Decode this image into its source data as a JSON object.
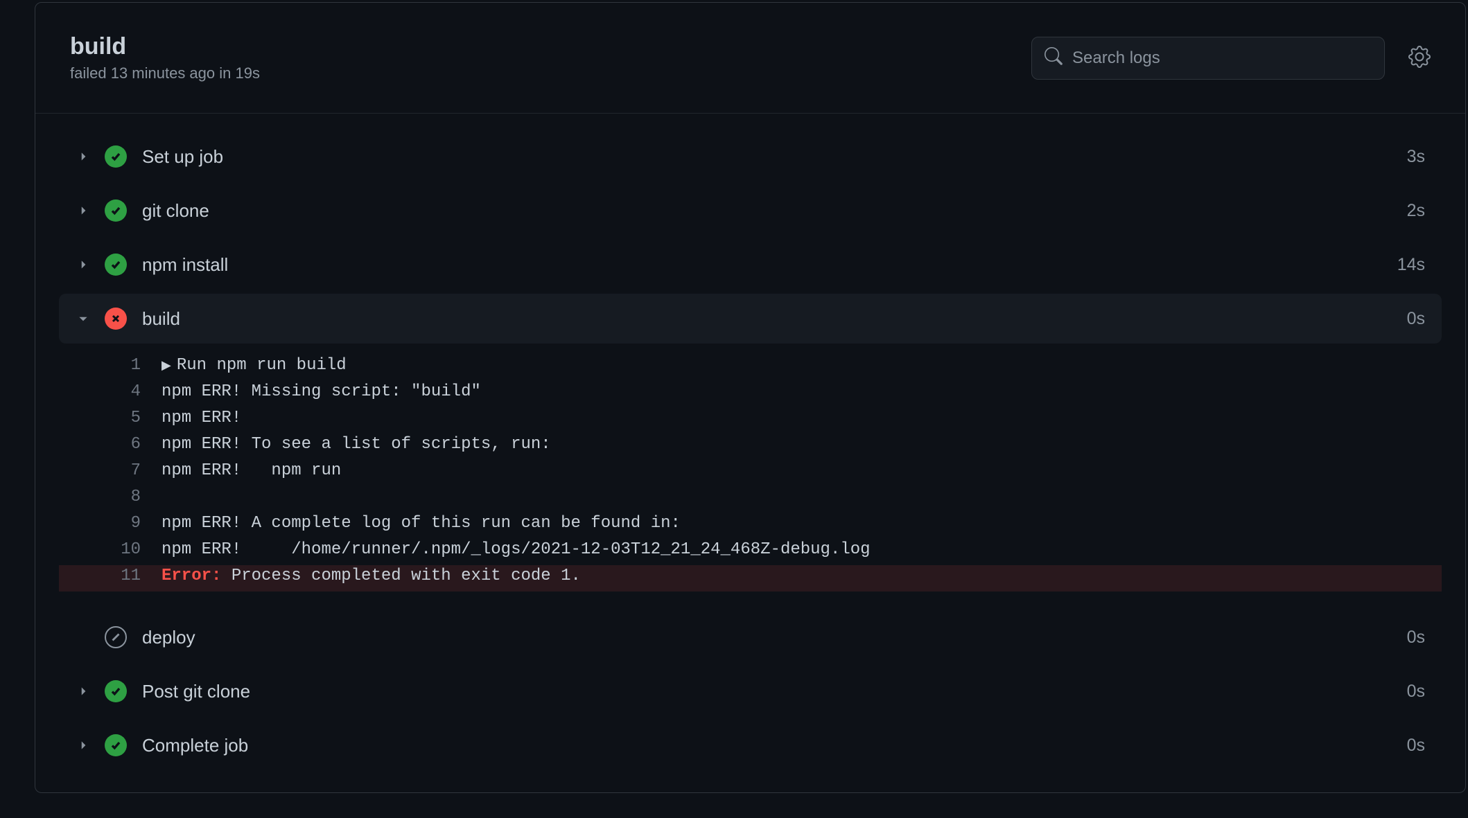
{
  "header": {
    "title": "build",
    "subtitle": "failed 13 minutes ago in 19s"
  },
  "search": {
    "placeholder": "Search logs"
  },
  "steps": [
    {
      "name": "Set up job",
      "duration": "3s",
      "status": "success",
      "expanded": false,
      "hasChevron": true
    },
    {
      "name": "git clone",
      "duration": "2s",
      "status": "success",
      "expanded": false,
      "hasChevron": true
    },
    {
      "name": "npm install",
      "duration": "14s",
      "status": "success",
      "expanded": false,
      "hasChevron": true
    },
    {
      "name": "build",
      "duration": "0s",
      "status": "fail",
      "expanded": true,
      "hasChevron": true
    },
    {
      "name": "deploy",
      "duration": "0s",
      "status": "skip",
      "expanded": false,
      "hasChevron": false
    },
    {
      "name": "Post git clone",
      "duration": "0s",
      "status": "success",
      "expanded": false,
      "hasChevron": true
    },
    {
      "name": "Complete job",
      "duration": "0s",
      "status": "success",
      "expanded": false,
      "hasChevron": true
    }
  ],
  "logs": [
    {
      "n": "1",
      "disclosure": true,
      "text": "Run npm run build"
    },
    {
      "n": "4",
      "text": "npm ERR! Missing script: \"build\""
    },
    {
      "n": "5",
      "text": "npm ERR!"
    },
    {
      "n": "6",
      "text": "npm ERR! To see a list of scripts, run:"
    },
    {
      "n": "7",
      "text": "npm ERR!   npm run"
    },
    {
      "n": "8",
      "text": ""
    },
    {
      "n": "9",
      "text": "npm ERR! A complete log of this run can be found in:"
    },
    {
      "n": "10",
      "text": "npm ERR!     /home/runner/.npm/_logs/2021-12-03T12_21_24_468Z-debug.log"
    },
    {
      "n": "11",
      "errPrefix": "Error:",
      "text": " Process completed with exit code 1.",
      "highlight": true
    }
  ]
}
